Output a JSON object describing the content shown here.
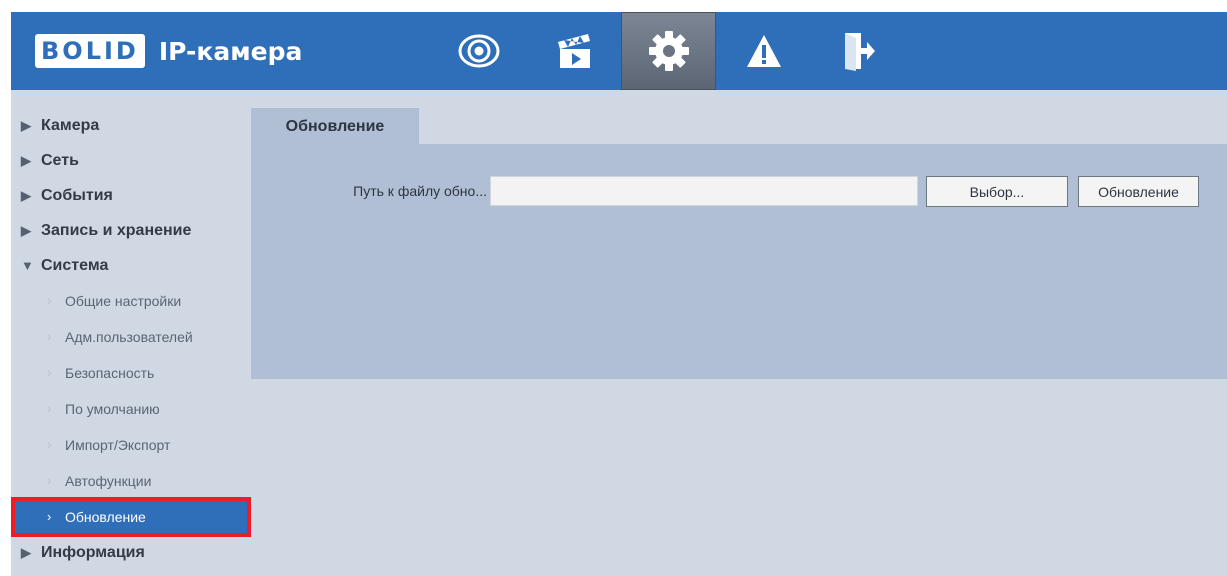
{
  "header": {
    "brand": "BOLID",
    "title": "IP-камера",
    "nav": [
      {
        "icon": "eye-icon",
        "active": false
      },
      {
        "icon": "clapperboard-icon",
        "active": false
      },
      {
        "icon": "gear-icon",
        "active": true
      },
      {
        "icon": "warning-icon",
        "active": false
      },
      {
        "icon": "logout-icon",
        "active": false
      }
    ]
  },
  "sidebar": {
    "camera": "Камера",
    "network": "Сеть",
    "events": "События",
    "storage": "Запись и хранение",
    "system": "Система",
    "system_items": {
      "general": "Общие настройки",
      "users": "Адм.пользователей",
      "security": "Безопасность",
      "defaults": "По умолчанию",
      "import_export": "Импорт/Экспорт",
      "auto": "Автофункции",
      "upgrade": "Обновление"
    },
    "info": "Информация"
  },
  "content": {
    "tab": "Обновление",
    "path_label": "Путь к файлу обно...",
    "path_value": "",
    "choose_button": "Выбор...",
    "update_button": "Обновление"
  },
  "colors": {
    "accent": "#2f6fba",
    "panel": "#b0bfd3",
    "background": "#d0d8e3",
    "highlight": "#ee1c24"
  }
}
